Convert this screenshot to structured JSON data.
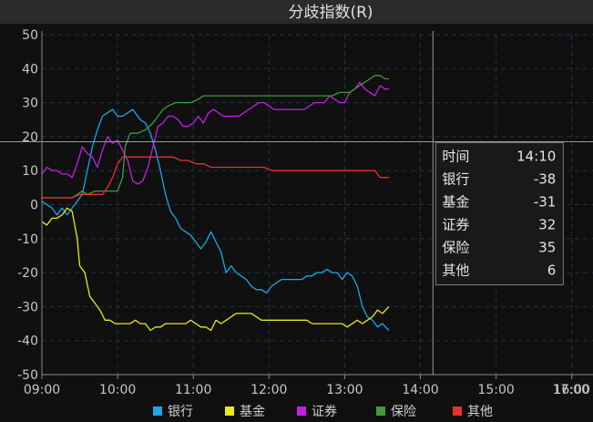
{
  "chart_data": {
    "type": "line",
    "title": "分歧指数(R)",
    "xlabel": "",
    "ylabel": "",
    "ylim": [
      -50,
      50
    ],
    "yticks": [
      50,
      40,
      30,
      20,
      10,
      0,
      -10,
      -20,
      -30,
      -40,
      -50
    ],
    "xticks": [
      "09:00",
      "10:00",
      "11:00",
      "12:00",
      "13:00",
      "14:00",
      "15:00",
      "16:00",
      "17:00"
    ],
    "x_unit": "minutes since 09:00",
    "grid": true,
    "legend_position": "bottom",
    "colors": {
      "background": "#101010",
      "title_bar": "#2a2a2a",
      "grid": "#1e3448",
      "crosshair": "#9a9a9a",
      "tooltip_bg": "#1a1a1a",
      "tooltip_border": "#7a7a7a"
    },
    "crosshair": {
      "x_time": "14:10",
      "y_value": 18.5
    },
    "series": [
      {
        "name": "银行",
        "color": "#1aa7e8",
        "points": [
          [
            0,
            1
          ],
          [
            4,
            0
          ],
          [
            8,
            -1
          ],
          [
            12,
            -3
          ],
          [
            16,
            -1
          ],
          [
            20,
            -3
          ],
          [
            24,
            -1
          ],
          [
            28,
            1
          ],
          [
            32,
            3
          ],
          [
            36,
            10
          ],
          [
            40,
            17
          ],
          [
            44,
            22
          ],
          [
            48,
            26
          ],
          [
            52,
            27
          ],
          [
            56,
            28
          ],
          [
            60,
            26
          ],
          [
            64,
            26
          ],
          [
            68,
            27
          ],
          [
            72,
            28
          ],
          [
            74,
            27
          ],
          [
            78,
            25
          ],
          [
            82,
            24
          ],
          [
            86,
            21
          ],
          [
            90,
            16
          ],
          [
            94,
            10
          ],
          [
            98,
            3
          ],
          [
            102,
            -2
          ],
          [
            106,
            -4
          ],
          [
            110,
            -7
          ],
          [
            114,
            -8
          ],
          [
            118,
            -9
          ],
          [
            122,
            -11
          ],
          [
            126,
            -13
          ],
          [
            130,
            -11
          ],
          [
            134,
            -8
          ],
          [
            138,
            -11
          ],
          [
            142,
            -14
          ],
          [
            146,
            -20
          ],
          [
            150,
            -18
          ],
          [
            154,
            -20
          ],
          [
            158,
            -21
          ],
          [
            162,
            -22
          ],
          [
            166,
            -24
          ],
          [
            170,
            -25
          ],
          [
            174,
            -25
          ],
          [
            178,
            -26
          ],
          [
            182,
            -24
          ],
          [
            186,
            -23
          ],
          [
            190,
            -22
          ],
          [
            194,
            -22
          ],
          [
            198,
            -22
          ],
          [
            202,
            -22
          ],
          [
            206,
            -22
          ],
          [
            210,
            -21
          ],
          [
            214,
            -21
          ],
          [
            218,
            -20
          ],
          [
            222,
            -20
          ],
          [
            226,
            -19
          ],
          [
            230,
            -20
          ],
          [
            234,
            -20
          ],
          [
            238,
            -22
          ],
          [
            242,
            -20
          ],
          [
            246,
            -21
          ],
          [
            250,
            -24
          ],
          [
            254,
            -30
          ],
          [
            258,
            -33
          ],
          [
            262,
            -34
          ],
          [
            266,
            -36
          ],
          [
            270,
            -35
          ],
          [
            275,
            -37
          ]
        ]
      },
      {
        "name": "基金",
        "color": "#e8e81a",
        "points": [
          [
            0,
            -5
          ],
          [
            4,
            -6
          ],
          [
            8,
            -4
          ],
          [
            12,
            -4
          ],
          [
            16,
            -3
          ],
          [
            20,
            -1
          ],
          [
            24,
            -2
          ],
          [
            28,
            -10
          ],
          [
            30,
            -18
          ],
          [
            34,
            -20
          ],
          [
            38,
            -27
          ],
          [
            42,
            -29
          ],
          [
            46,
            -31
          ],
          [
            50,
            -34
          ],
          [
            54,
            -34
          ],
          [
            58,
            -35
          ],
          [
            62,
            -35
          ],
          [
            66,
            -35
          ],
          [
            70,
            -35
          ],
          [
            74,
            -34
          ],
          [
            78,
            -35
          ],
          [
            82,
            -35
          ],
          [
            86,
            -37
          ],
          [
            90,
            -36
          ],
          [
            94,
            -36
          ],
          [
            98,
            -35
          ],
          [
            102,
            -35
          ],
          [
            106,
            -35
          ],
          [
            110,
            -35
          ],
          [
            114,
            -35
          ],
          [
            118,
            -34
          ],
          [
            122,
            -35
          ],
          [
            126,
            -36
          ],
          [
            130,
            -36
          ],
          [
            134,
            -37
          ],
          [
            138,
            -34
          ],
          [
            142,
            -35
          ],
          [
            146,
            -34
          ],
          [
            150,
            -33
          ],
          [
            154,
            -32
          ],
          [
            158,
            -32
          ],
          [
            162,
            -32
          ],
          [
            166,
            -32
          ],
          [
            170,
            -33
          ],
          [
            174,
            -34
          ],
          [
            178,
            -34
          ],
          [
            182,
            -34
          ],
          [
            186,
            -34
          ],
          [
            190,
            -34
          ],
          [
            194,
            -34
          ],
          [
            198,
            -34
          ],
          [
            202,
            -34
          ],
          [
            206,
            -34
          ],
          [
            210,
            -34
          ],
          [
            214,
            -35
          ],
          [
            218,
            -35
          ],
          [
            222,
            -35
          ],
          [
            226,
            -35
          ],
          [
            230,
            -35
          ],
          [
            234,
            -35
          ],
          [
            238,
            -35
          ],
          [
            242,
            -36
          ],
          [
            246,
            -35
          ],
          [
            250,
            -34
          ],
          [
            254,
            -35
          ],
          [
            258,
            -34
          ],
          [
            262,
            -33
          ],
          [
            266,
            -31
          ],
          [
            270,
            -32
          ],
          [
            275,
            -30
          ]
        ]
      },
      {
        "name": "证券",
        "color": "#c51ee8",
        "points": [
          [
            0,
            9
          ],
          [
            4,
            11
          ],
          [
            8,
            10
          ],
          [
            12,
            10
          ],
          [
            16,
            9
          ],
          [
            20,
            9
          ],
          [
            24,
            8
          ],
          [
            28,
            12
          ],
          [
            32,
            17
          ],
          [
            36,
            15
          ],
          [
            40,
            14
          ],
          [
            44,
            11
          ],
          [
            48,
            16
          ],
          [
            52,
            20
          ],
          [
            56,
            18
          ],
          [
            60,
            19
          ],
          [
            64,
            16
          ],
          [
            68,
            13
          ],
          [
            72,
            7
          ],
          [
            76,
            6
          ],
          [
            80,
            7
          ],
          [
            84,
            11
          ],
          [
            88,
            17
          ],
          [
            92,
            23
          ],
          [
            96,
            24
          ],
          [
            100,
            26
          ],
          [
            104,
            26
          ],
          [
            108,
            25
          ],
          [
            112,
            23
          ],
          [
            116,
            23
          ],
          [
            120,
            24
          ],
          [
            124,
            26
          ],
          [
            128,
            24
          ],
          [
            132,
            27
          ],
          [
            136,
            28
          ],
          [
            140,
            27
          ],
          [
            144,
            26
          ],
          [
            148,
            26
          ],
          [
            152,
            26
          ],
          [
            156,
            26
          ],
          [
            160,
            27
          ],
          [
            164,
            28
          ],
          [
            168,
            29
          ],
          [
            172,
            30
          ],
          [
            176,
            30
          ],
          [
            180,
            29
          ],
          [
            184,
            28
          ],
          [
            188,
            28
          ],
          [
            192,
            28
          ],
          [
            196,
            28
          ],
          [
            200,
            28
          ],
          [
            204,
            28
          ],
          [
            208,
            28
          ],
          [
            212,
            29
          ],
          [
            216,
            30
          ],
          [
            220,
            30
          ],
          [
            224,
            30
          ],
          [
            228,
            32
          ],
          [
            232,
            31
          ],
          [
            236,
            30
          ],
          [
            240,
            30
          ],
          [
            244,
            33
          ],
          [
            248,
            34
          ],
          [
            252,
            36
          ],
          [
            256,
            34
          ],
          [
            260,
            33
          ],
          [
            264,
            32
          ],
          [
            268,
            35
          ],
          [
            272,
            34
          ],
          [
            275,
            34
          ]
        ]
      },
      {
        "name": "保险",
        "color": "#3f9a3f",
        "points": [
          [
            0,
            2
          ],
          [
            6,
            2
          ],
          [
            12,
            2
          ],
          [
            18,
            2
          ],
          [
            24,
            2
          ],
          [
            28,
            3
          ],
          [
            32,
            4
          ],
          [
            36,
            3
          ],
          [
            42,
            4
          ],
          [
            48,
            4
          ],
          [
            54,
            4
          ],
          [
            60,
            4
          ],
          [
            64,
            8
          ],
          [
            66,
            17
          ],
          [
            70,
            21
          ],
          [
            76,
            21
          ],
          [
            82,
            22
          ],
          [
            88,
            24
          ],
          [
            92,
            26
          ],
          [
            96,
            28
          ],
          [
            100,
            29
          ],
          [
            106,
            30
          ],
          [
            112,
            30
          ],
          [
            118,
            30
          ],
          [
            124,
            31
          ],
          [
            128,
            32
          ],
          [
            134,
            32
          ],
          [
            140,
            32
          ],
          [
            146,
            32
          ],
          [
            152,
            32
          ],
          [
            158,
            32
          ],
          [
            164,
            32
          ],
          [
            170,
            32
          ],
          [
            176,
            32
          ],
          [
            182,
            32
          ],
          [
            188,
            32
          ],
          [
            194,
            32
          ],
          [
            200,
            32
          ],
          [
            206,
            32
          ],
          [
            212,
            32
          ],
          [
            218,
            32
          ],
          [
            224,
            32
          ],
          [
            230,
            32
          ],
          [
            236,
            33
          ],
          [
            240,
            33
          ],
          [
            244,
            33
          ],
          [
            248,
            34
          ],
          [
            252,
            35
          ],
          [
            256,
            36
          ],
          [
            260,
            37
          ],
          [
            264,
            38
          ],
          [
            268,
            38
          ],
          [
            272,
            37
          ],
          [
            275,
            37
          ]
        ]
      },
      {
        "name": "其他",
        "color": "#e83030",
        "points": [
          [
            0,
            2
          ],
          [
            6,
            2
          ],
          [
            12,
            2
          ],
          [
            18,
            2
          ],
          [
            24,
            2
          ],
          [
            30,
            3
          ],
          [
            36,
            3
          ],
          [
            42,
            3
          ],
          [
            48,
            3
          ],
          [
            52,
            5
          ],
          [
            56,
            8
          ],
          [
            60,
            12
          ],
          [
            64,
            14
          ],
          [
            68,
            14
          ],
          [
            74,
            14
          ],
          [
            80,
            14
          ],
          [
            86,
            14
          ],
          [
            92,
            14
          ],
          [
            98,
            14
          ],
          [
            104,
            14
          ],
          [
            110,
            13
          ],
          [
            116,
            13
          ],
          [
            122,
            12
          ],
          [
            128,
            12
          ],
          [
            134,
            11
          ],
          [
            140,
            11
          ],
          [
            146,
            11
          ],
          [
            152,
            11
          ],
          [
            158,
            11
          ],
          [
            164,
            11
          ],
          [
            170,
            11
          ],
          [
            176,
            11
          ],
          [
            182,
            10
          ],
          [
            188,
            10
          ],
          [
            194,
            10
          ],
          [
            200,
            10
          ],
          [
            206,
            10
          ],
          [
            212,
            10
          ],
          [
            218,
            10
          ],
          [
            224,
            10
          ],
          [
            230,
            10
          ],
          [
            236,
            10
          ],
          [
            240,
            10
          ],
          [
            244,
            10
          ],
          [
            248,
            10
          ],
          [
            252,
            10
          ],
          [
            256,
            10
          ],
          [
            260,
            10
          ],
          [
            264,
            10
          ],
          [
            268,
            8
          ],
          [
            272,
            8
          ],
          [
            275,
            8
          ]
        ]
      }
    ],
    "tooltip": {
      "rows": [
        {
          "label": "时间",
          "value": "14:10"
        },
        {
          "label": "银行",
          "value": "-38"
        },
        {
          "label": "基金",
          "value": "-31"
        },
        {
          "label": "证券",
          "value": "32"
        },
        {
          "label": "保险",
          "value": "35"
        },
        {
          "label": "其他",
          "value": "6"
        }
      ]
    }
  }
}
